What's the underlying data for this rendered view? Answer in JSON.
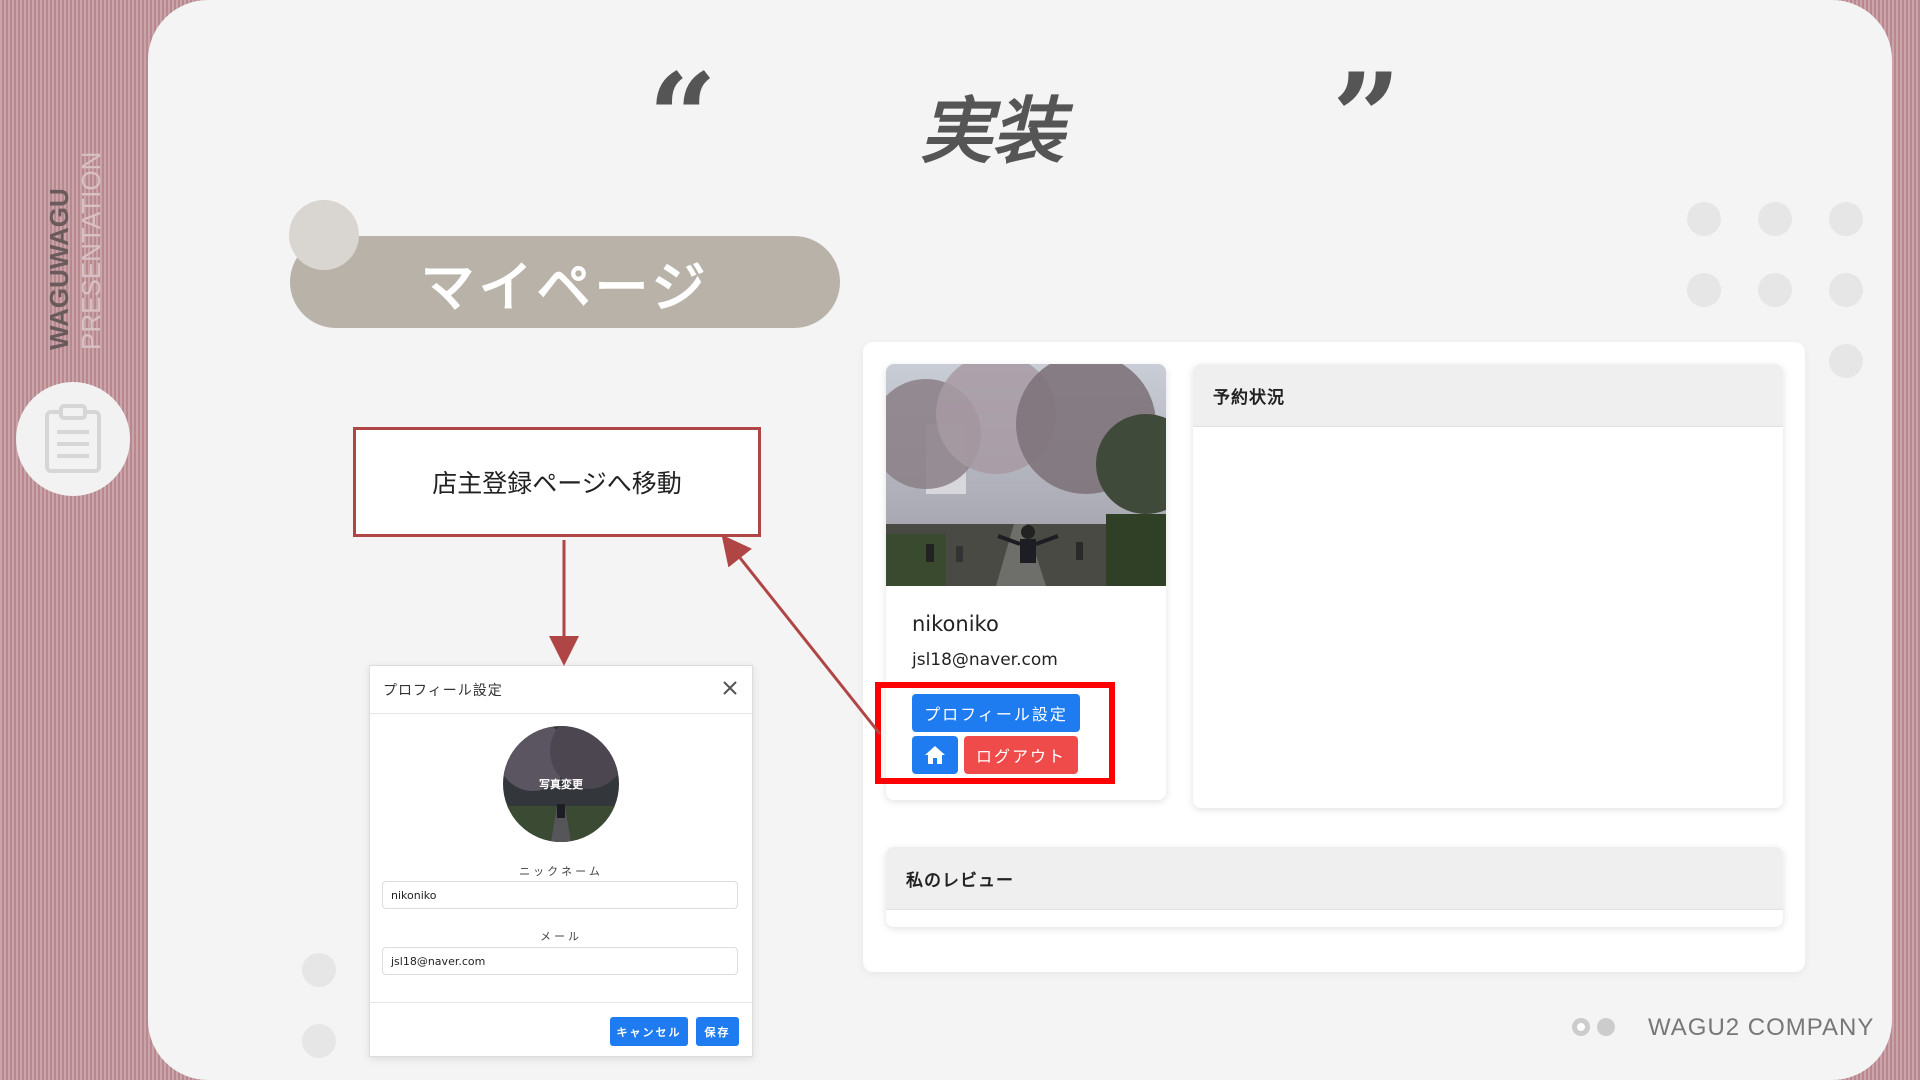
{
  "sidebar": {
    "brand": "WAGUWAGU",
    "subtitle": "PRESENTATION",
    "icon": "clipboard-icon"
  },
  "slide": {
    "title": "実装",
    "open_quote": "“",
    "close_quote": "”",
    "section_label": "マイページ",
    "callout_text": "店主登録ページへ移動",
    "footer_text": "WAGU2 COMPANY"
  },
  "profile_card": {
    "nickname": "nikoniko",
    "email": "jsl18@naver.com",
    "profile_settings_button": "プロフィール設定",
    "home_icon": "home-icon",
    "logout_button": "ログアウト"
  },
  "reservation_card": {
    "header": "予約状況"
  },
  "review_card": {
    "header": "私のレビュー"
  },
  "modal": {
    "title": "プロフィール設定",
    "close_icon": "close-icon",
    "photo_change_label": "写真変更",
    "nickname_label": "ニックネーム",
    "nickname_value": "nikoniko",
    "email_label": "メール",
    "email_value": "jsl18@naver.com",
    "cancel_button": "キャンセル",
    "save_button": "保存"
  },
  "colors": {
    "primary_button": "#1e7cf0",
    "logout_button": "#ef4b4b",
    "highlight_border": "#ff0000",
    "arrow": "#b04545",
    "pill": "#b9b2a8"
  }
}
